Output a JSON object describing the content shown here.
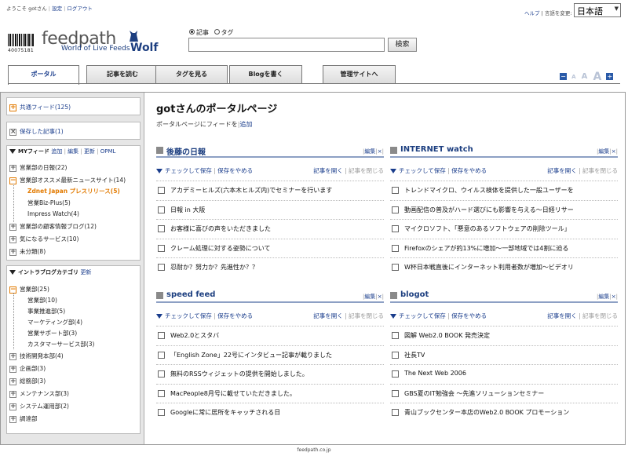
{
  "topbar": {
    "welcome": "ようこそ gotさん",
    "settings": "設定",
    "logout": "ログアウト",
    "help": "ヘルプ",
    "lang_label": "言語を変更",
    "lang_value": "日本語"
  },
  "logo": {
    "barcode_number": "40075181",
    "brand": "feedpath",
    "tagline": "World of Live Feeds",
    "edition": "Wolf"
  },
  "search": {
    "radio_article": "記事",
    "radio_tag": "タグ",
    "button": "検索",
    "value": ""
  },
  "tabs": [
    "ポータル",
    "記事を読む",
    "タグを見る",
    "Blogを書く",
    "管理サイトへ"
  ],
  "sidebar": {
    "shared_feed": "共通フィード(125)",
    "saved": "保存した記事(1)",
    "my_feed_title": "MYフィード",
    "my_feed_actions": [
      "追加",
      "編集",
      "更新",
      "OPML"
    ],
    "my_feed_items": [
      "営業部の日報(22)",
      "営業部オススメ最新ニュースサイト(14)",
      "Zdnet Japan プレスリリース(5)",
      "営業Biz-Plus(5)",
      "Impress Watch(4)",
      "営業部の顧客情報ブログ(12)",
      "気になるサービス(10)",
      "未分類(8)"
    ],
    "intra_title": "イントラブログカテゴリ",
    "intra_update": "更新",
    "intra_items": [
      "営業部(25)",
      "営業部(10)",
      "事業推進部(5)",
      "マーケティング部(4)",
      "営業サポート部(3)",
      "カスタマーサービス部(3)",
      "技術開発本部(4)",
      "企画部(3)",
      "総務部(3)",
      "メンテナンス部(3)",
      "システム運用部(2)",
      "調達部"
    ]
  },
  "main": {
    "title": "gotさんのポータルページ",
    "subtitle": "ポータルページにフィードを",
    "add_link": "追加"
  },
  "box_common": {
    "edit": "編集",
    "close": "×",
    "check_save": "チェックして保存",
    "stop_save": "保存をやめる",
    "open": "記事を開く",
    "close_article": "記事を閉じる"
  },
  "boxes": [
    {
      "title": "後藤の日報",
      "items": [
        "アカデミーヒルズ(六本木ヒルズ内)でセミナーを行います",
        "日報 in 大阪",
        "お客様に喜びの声をいただきました",
        "クレーム処理に対する姿勢について",
        "忍耐か？努力か？先進性か？？"
      ]
    },
    {
      "title": "INTERNET watch",
      "items": [
        "トレンドマイクロ、ウイルス検体を提供した一般ユーザーを",
        "動画配信の普及がハード選びにも影響を与える〜日経リサー",
        "マイクロソフト、「悪意のあるソフトウェアの削除ツール」",
        "Firefoxのシェアが約13%に増加〜一部地域では4割に迫る",
        "W杯日本戦直後にインターネット利用者数が増加〜ビデオリ"
      ]
    },
    {
      "title": "speed feed",
      "items": [
        "Web2.0とスタバ",
        "「English Zone」22号にインタビュー記事が載りました",
        "無料のRSSウィジェットの提供を開始しました。",
        "MacPeople8月号に載せていただきました。",
        "Googleに常に居所をキャッチされる日"
      ]
    },
    {
      "title": "blogot",
      "items": [
        "図解 Web2.0 BOOK 発売決定",
        "社長TV",
        "The Next Web 2006",
        "GBS夏のIT勉強会 〜先進ソリューションセミナー",
        "青山ブックセンター本店のWeb2.0 BOOK プロモーション"
      ]
    }
  ],
  "footer": "feedpath.co.jp",
  "colors": {
    "accent": "#1d3f80",
    "orange": "#e27a00",
    "sidebar_bg": "#e6e6e6"
  }
}
